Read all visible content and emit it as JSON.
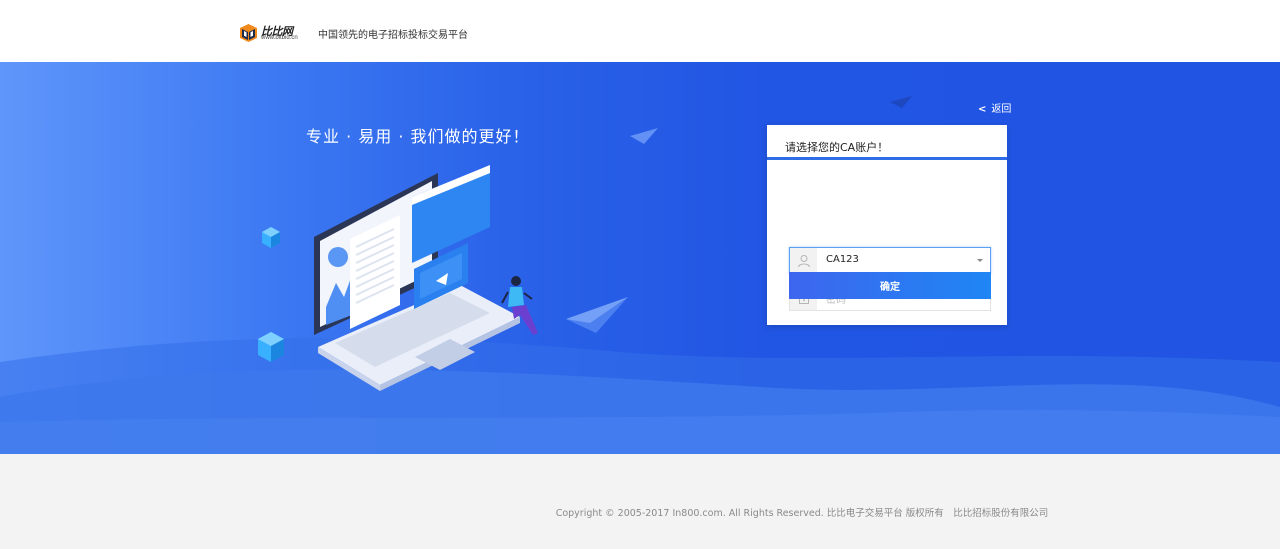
{
  "header": {
    "logo_name": "比比网",
    "logo_url": "www.bitbid.cn",
    "slogan": "中国领先的电子招标投标交易平台"
  },
  "hero": {
    "title": "专业 · 易用 · 我们做的更好！"
  },
  "back_link": {
    "chevron": "<",
    "label": "返回"
  },
  "login": {
    "heading": "请选择您的CA账户！",
    "account": {
      "value": "CA123",
      "icon": "user-icon"
    },
    "password": {
      "placeholder": "密码",
      "icon": "lock-icon"
    },
    "submit_label": "确定"
  },
  "footer": {
    "copyright": "Copyright © 2005-2017 In800.com. All Rights Reserved. 比比电子交易平台 版权所有　比比招标股份有限公司"
  },
  "colors": {
    "hero_blue": "#2155e3",
    "hero_light": "#5f96fb",
    "button_start": "#3d66ee",
    "button_end": "#1f86f4",
    "footer_bg": "#f3f3f3"
  }
}
